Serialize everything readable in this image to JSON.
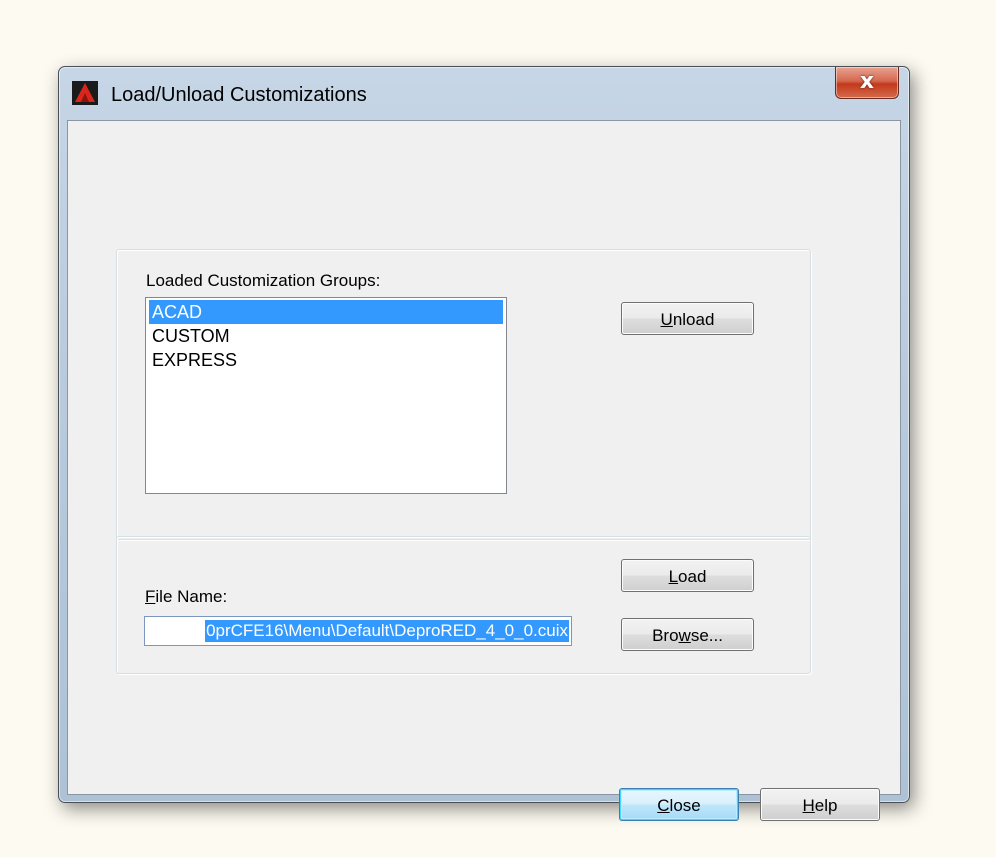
{
  "window": {
    "title": "Load/Unload Customizations",
    "close_glyph": "x"
  },
  "groups_section": {
    "label": "Loaded Customization Groups:",
    "items": [
      "ACAD",
      "CUSTOM",
      "EXPRESS"
    ],
    "selected": "ACAD",
    "unload_button": {
      "accel": "U",
      "rest": "nload"
    }
  },
  "file_section": {
    "label": {
      "accel": "F",
      "rest": "ile Name:"
    },
    "file_value": "0prCFE16\\Menu\\Default\\DeproRED_4_0_0.cuix",
    "load_button": {
      "accel": "L",
      "rest": "oad"
    },
    "browse_button": {
      "pre": "Bro",
      "accel": "w",
      "rest": "se..."
    }
  },
  "footer": {
    "close_button": {
      "accel": "C",
      "rest": "lose"
    },
    "help_button": {
      "accel": "H",
      "rest": "elp"
    }
  },
  "colors": {
    "selection": "#3399ff",
    "close_red": "#c3391c",
    "dialog_bg": "#f0f0f0"
  },
  "icons": {
    "app": "autocad-icon",
    "close": "close-icon"
  }
}
